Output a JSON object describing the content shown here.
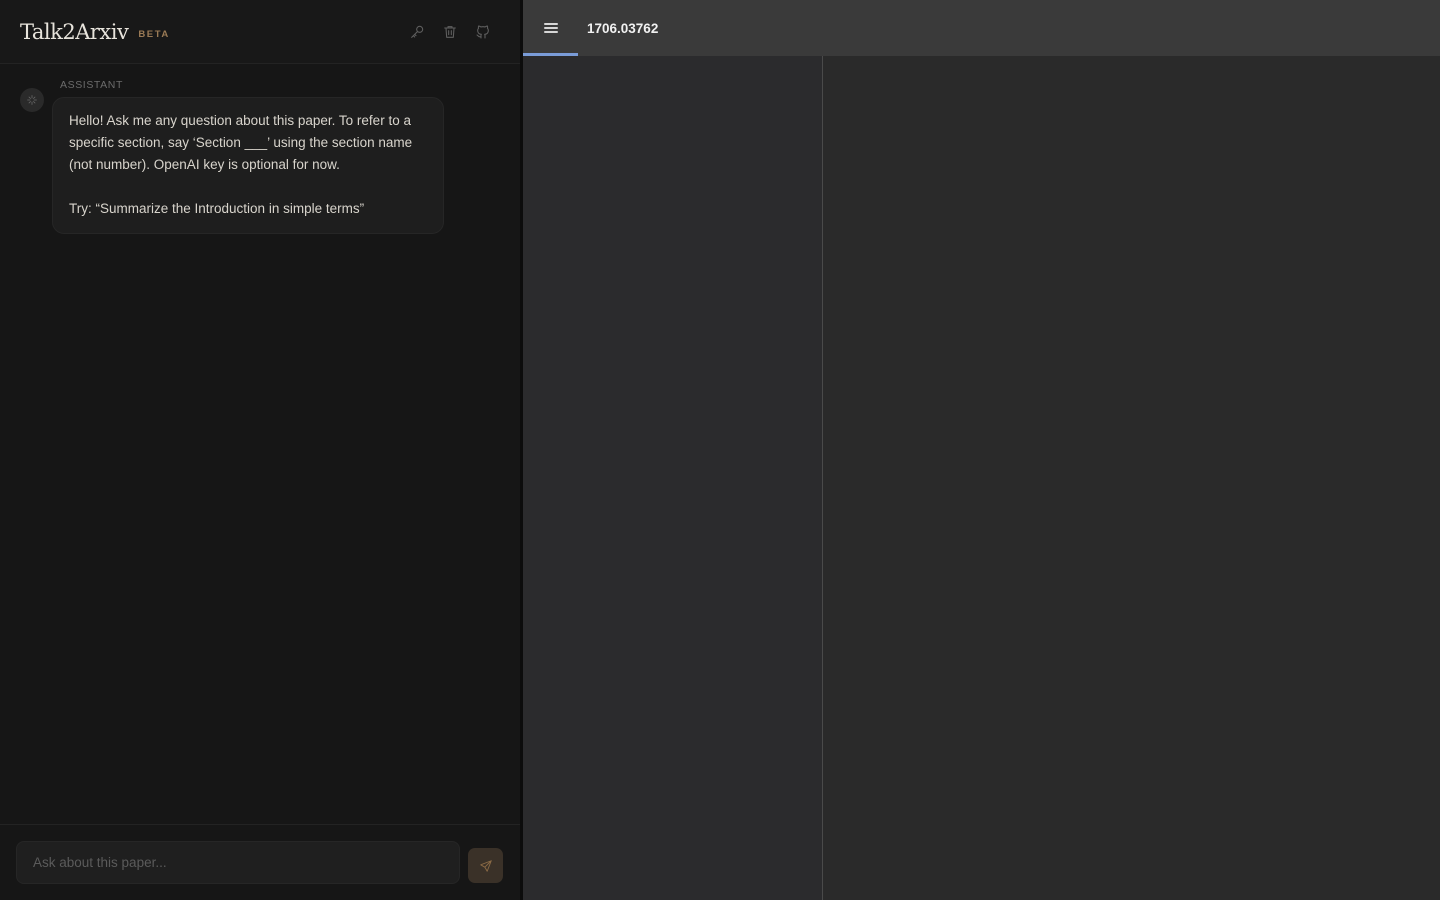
{
  "header": {
    "brand": "Talk2Arxiv",
    "badge": "BETA",
    "actions": [
      {
        "name": "api-key-button",
        "icon": "key-icon"
      },
      {
        "name": "clear-chat-button",
        "icon": "trash-icon"
      },
      {
        "name": "github-button",
        "icon": "github-icon"
      }
    ]
  },
  "chat": {
    "messages": [
      {
        "role": "ASSISTANT",
        "avatar_icon": "sparkle-icon",
        "lines": [
          "Hello! Ask me any question about this paper. To refer to a specific section, say ‘Section ___’ using the section name (not number). OpenAI key is optional for now.",
          "Try: “Summarize the Introduction in simple terms”"
        ]
      }
    ],
    "input": {
      "placeholder": "Ask about this paper...",
      "value": ""
    },
    "send_icon": "send-icon"
  },
  "viewer": {
    "toggle_icon": "hamburger-menu-icon",
    "document_title": "1706.03762"
  },
  "colors": {
    "accent_tab": "#7a9cd8",
    "badge": "#9a7a55",
    "send_button": "#3a3128"
  }
}
